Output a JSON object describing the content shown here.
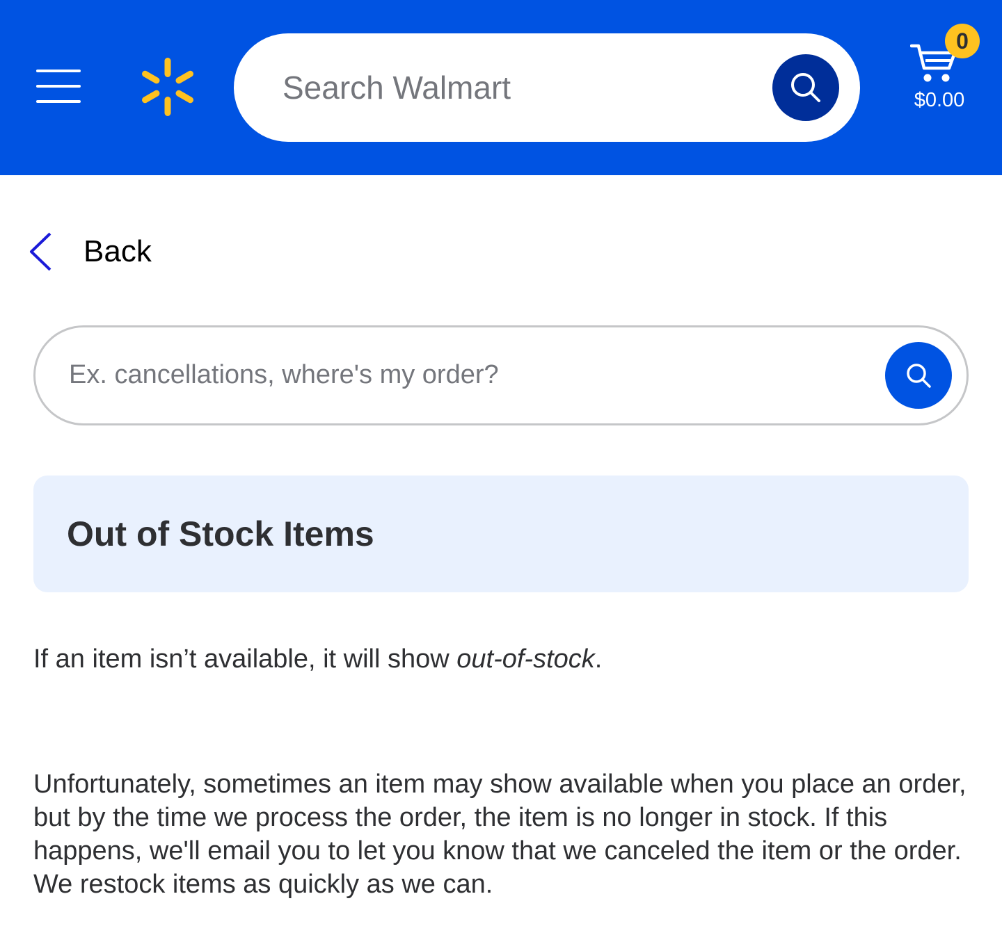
{
  "header": {
    "search_placeholder": "Search Walmart",
    "cart_count": "0",
    "cart_total": "$0.00",
    "brand_color": "#0053e2",
    "accent_color": "#ffc220",
    "icons": [
      "menu-icon",
      "spark-logo-icon",
      "search-icon",
      "cart-icon"
    ]
  },
  "back": {
    "label": "Back"
  },
  "help_search": {
    "placeholder": "Ex. cancellations, where's my order?"
  },
  "article": {
    "title": "Out of Stock Items",
    "para1_prefix": "If an item isn’t available, it will show ",
    "para1_emphasis": "out-of-stock",
    "para1_suffix": ".",
    "para2": "Unfortunately, sometimes an item may show available when you place an order, but by the time we process the order, the item is no longer in stock. If this happens, we'll email you to let you know that we canceled the item or the order. We restock items as quickly as we can."
  }
}
